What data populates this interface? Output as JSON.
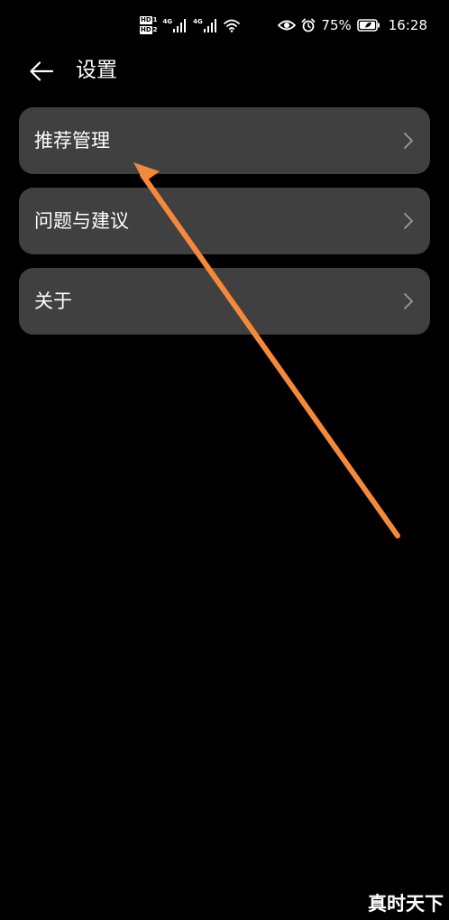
{
  "status_bar": {
    "sim1_badge": "HD",
    "sim1_number": "1",
    "sim2_badge": "HD",
    "sim2_number": "2",
    "sim1_network": "4G",
    "sim2_network": "4G",
    "battery_percent": "75%",
    "time": "16:28",
    "icons": [
      "eye-icon",
      "alarm-icon",
      "battery-icon",
      "wifi-icon",
      "signal-icon"
    ]
  },
  "header": {
    "title": "设置",
    "back_icon": "arrow-left-icon"
  },
  "menu": {
    "items": [
      {
        "label": "推荐管理"
      },
      {
        "label": "问题与建议"
      },
      {
        "label": "关于"
      }
    ]
  },
  "annotation": {
    "color": "#f5893a"
  },
  "watermark": {
    "text": "真时天下"
  },
  "colors": {
    "background": "#000000",
    "card": "#404040",
    "text": "#ffffff",
    "chevron": "#9a9a9a"
  }
}
